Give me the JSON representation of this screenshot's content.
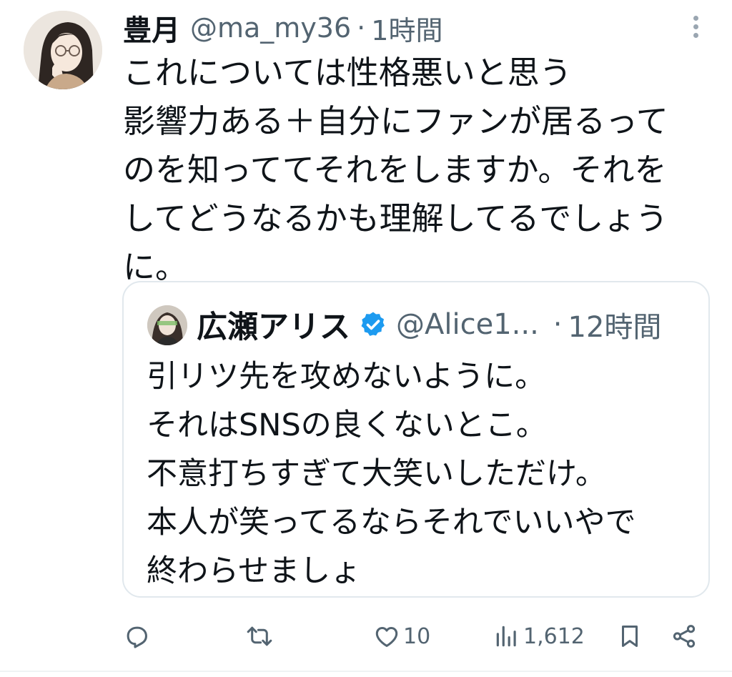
{
  "tweet": {
    "display_name": "豊月",
    "handle": "@ma_my36",
    "separator": "·",
    "time": "1時間",
    "lines": [
      "これについては性格悪いと思う",
      "影響力ある＋自分にファンが居るって",
      "のを知っててそれをしますか。それを",
      "してどうなるかも理解してるでしょう",
      "に。"
    ]
  },
  "quote": {
    "display_name": "広瀬アリス",
    "handle": "@Alice1...",
    "separator": "·",
    "time": "12時間",
    "lines": [
      "引リツ先を攻めないように。",
      "それはSNSの良くないとこ。",
      "不意打ちすぎて大笑いしただけ。",
      "本人が笑ってるならそれでいいやで",
      "終わらせましょ"
    ]
  },
  "actions": {
    "reply_icon": "reply-icon",
    "retweet_icon": "retweet-icon",
    "like_icon": "heart-icon",
    "like_count": "10",
    "views_icon": "views-icon",
    "views_count": "1,612",
    "bookmark_icon": "bookmark-icon",
    "share_icon": "share-icon"
  },
  "colors": {
    "text": "#0f1419",
    "muted": "#536471",
    "verified": "#1d9bf0",
    "border": "#e1e8ed"
  }
}
